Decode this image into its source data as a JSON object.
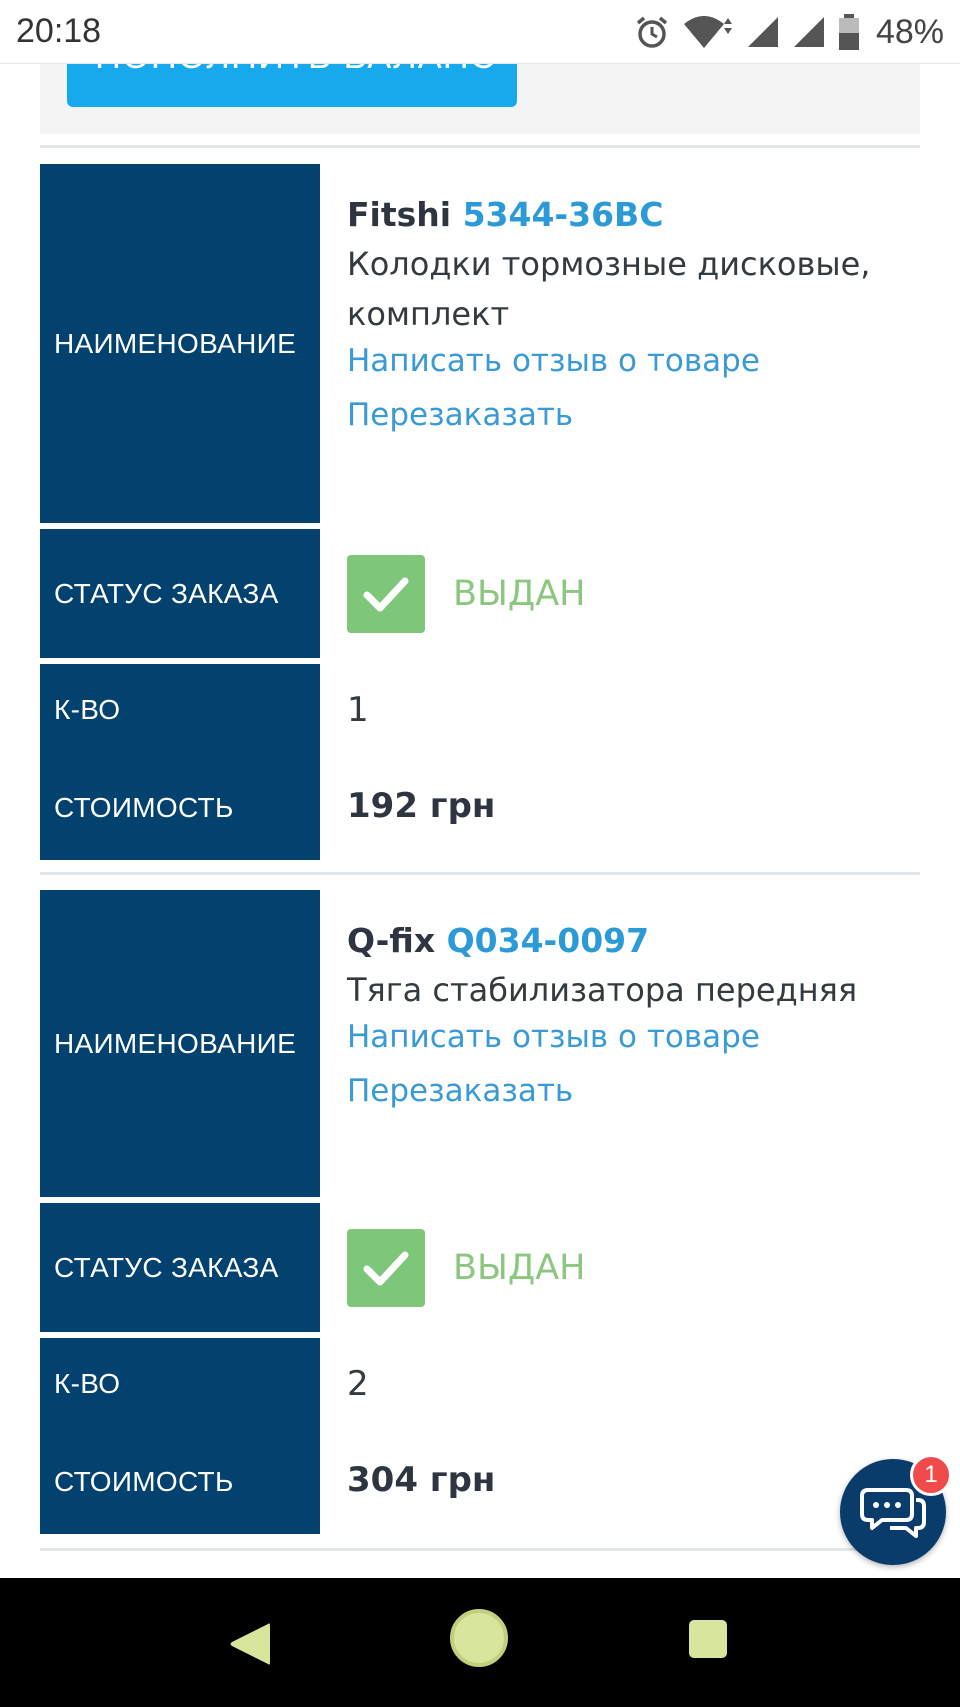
{
  "status_bar": {
    "time": "20:18",
    "battery": "48%",
    "icons": [
      "alarm-icon",
      "wifi-icon",
      "signal-icon",
      "signal-icon",
      "battery-icon"
    ]
  },
  "top_panel": {
    "topup_label": "Пополнить баланс"
  },
  "labels": {
    "name": "НАИМЕНОВАНИЕ",
    "status": "СТАТУС ЗАКАЗА",
    "qty": "К-ВО",
    "cost": "СТОИМОСТЬ",
    "review_link": "Написать отзыв о товаре",
    "reorder_link": "Перезаказать"
  },
  "orders": [
    {
      "brand": "Fitshi",
      "code": "5344-36BC",
      "desc_line1": "Колодки тормозные дисковые,",
      "desc_line2": "комплект",
      "status": "ВЫДАН",
      "qty": "1",
      "price": "192 грн"
    },
    {
      "brand": "Q-fix",
      "code": "Q034-0097",
      "desc_line1": "Тяга стабилизатора передняя",
      "status": "ВЫДАН",
      "qty": "2",
      "price": "304 грн"
    }
  ],
  "chat": {
    "badge_count": "1",
    "icon": "chat-icon"
  },
  "nav": {
    "icons": [
      "back-icon",
      "home-icon",
      "recents-icon"
    ]
  },
  "colors": {
    "label_bg": "#03426f",
    "link": "#3a9ad6",
    "status_green": "#7ec67a",
    "button_blue": "#16a9ec"
  }
}
